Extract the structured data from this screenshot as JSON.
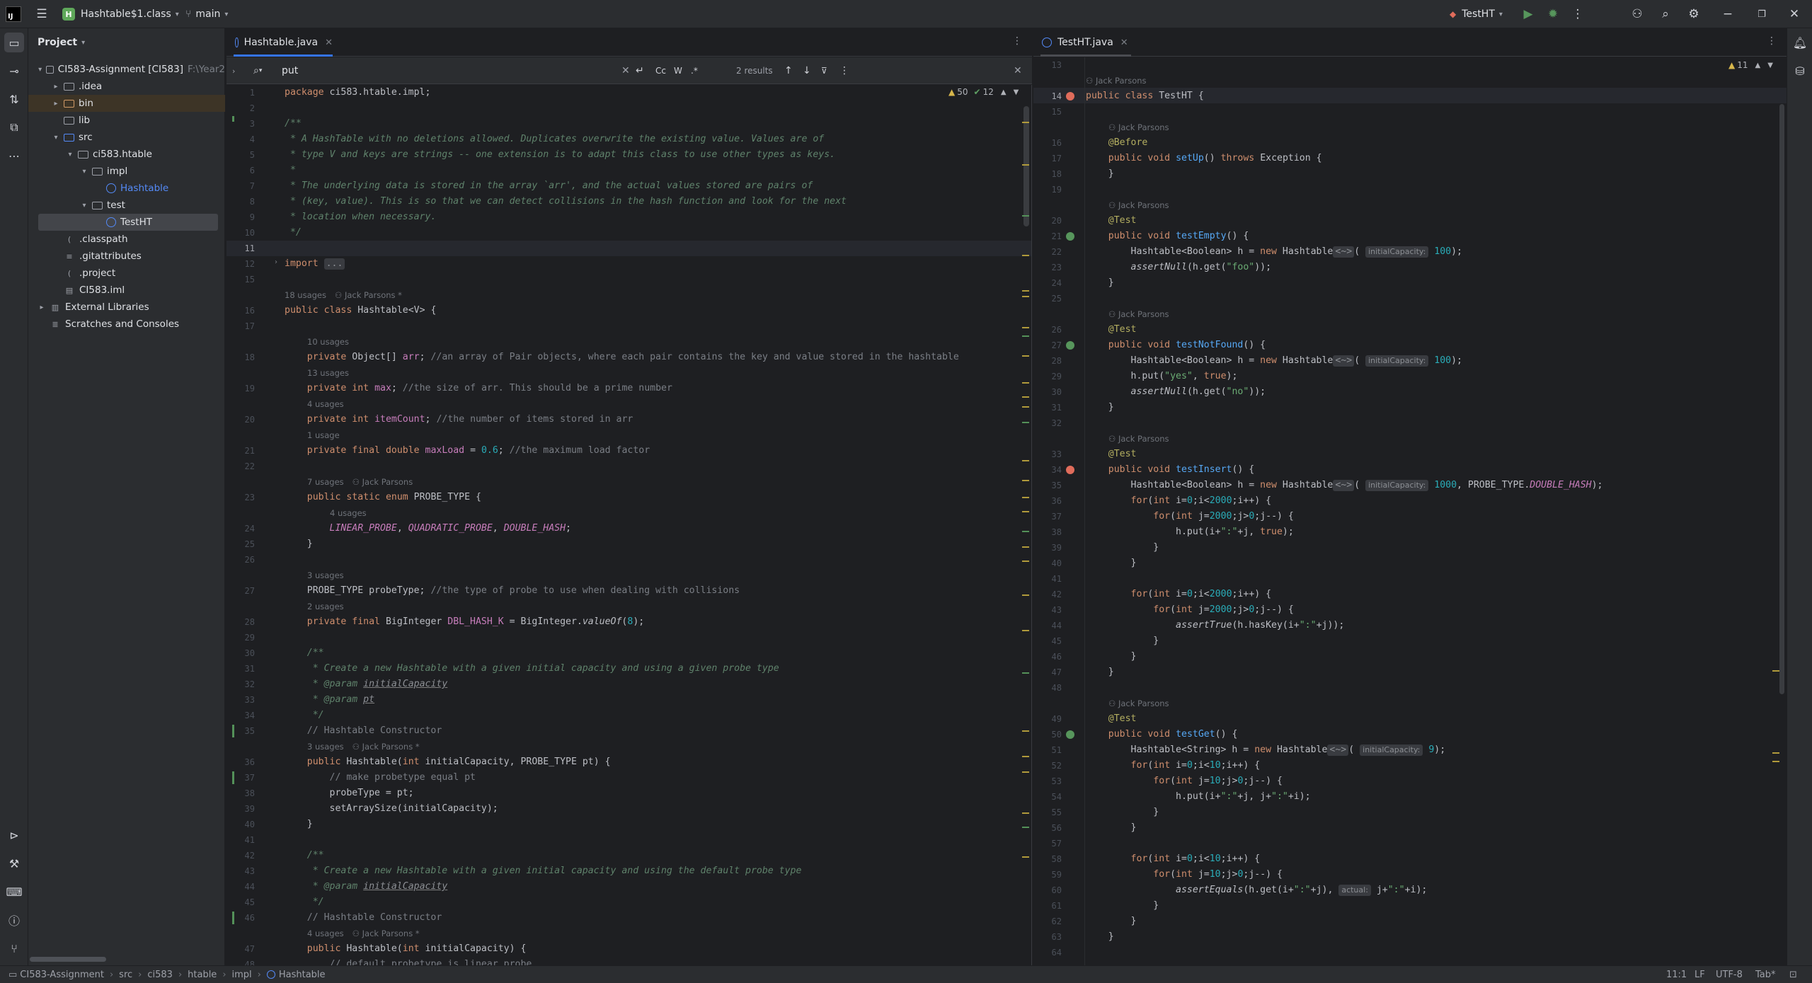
{
  "titlebar": {
    "project_badge": "H",
    "project_name": "Hashtable$1.class",
    "branch": "main",
    "run_config": "TestHT"
  },
  "project_panel": {
    "title": "Project",
    "tree": [
      {
        "label": "CI583-Assignment [CI583]",
        "suffix": "F:\\Year2"
      },
      {
        "label": ".idea"
      },
      {
        "label": "bin"
      },
      {
        "label": "lib"
      },
      {
        "label": "src"
      },
      {
        "label": "ci583.htable"
      },
      {
        "label": "impl"
      },
      {
        "label": "Hashtable"
      },
      {
        "label": "test"
      },
      {
        "label": "TestHT"
      },
      {
        "label": ".classpath"
      },
      {
        "label": ".gitattributes"
      },
      {
        "label": ".project"
      },
      {
        "label": "CI583.iml"
      },
      {
        "label": "External Libraries"
      },
      {
        "label": "Scratches and Consoles"
      }
    ]
  },
  "left_editor": {
    "tab": "Hashtable.java",
    "search": {
      "query": "put",
      "results": "2 results",
      "opt_case": "Cc",
      "opt_words": "W",
      "opt_regex": ".*"
    },
    "problems": {
      "warnings": "50",
      "checks": "12"
    }
  },
  "right_editor": {
    "tab": "TestHT.java",
    "problems": {
      "warnings": "11"
    }
  },
  "statusbar": {
    "breadcrumbs": [
      "CI583-Assignment",
      "src",
      "ci583",
      "htable",
      "impl",
      "Hashtable"
    ],
    "position": "11:1",
    "line_sep": "LF",
    "encoding": "UTF-8",
    "indent": "Tab*"
  },
  "inlays": {
    "u18": "18 usages",
    "u10": "10 usages",
    "u13": "13 usages",
    "u4": "4 usages",
    "u1": "1 usage",
    "u7": "7 usages",
    "u3": "3 usages",
    "u2": "2 usages",
    "author": "Jack Parsons",
    "author_star": "Jack Parsons *"
  },
  "hints": {
    "initialCapacity": "initialCapacity:",
    "actual": "actual:"
  },
  "code_left": [
    {
      "n": "1",
      "text": "package ci583.htable.impl;"
    },
    {
      "n": "2",
      "text": ""
    },
    {
      "n": "3",
      "text": "/**"
    },
    {
      "n": "4",
      "text": " * A HashTable with no deletions allowed. Duplicates overwrite the existing value. Values are of"
    },
    {
      "n": "5",
      "text": " * type V and keys are strings -- one extension is to adapt this class to use other types as keys."
    },
    {
      "n": "6",
      "text": " *"
    },
    {
      "n": "7",
      "text": " * The underlying data is stored in the array `arr', and the actual values stored are pairs of"
    },
    {
      "n": "8",
      "text": " * (key, value). This is so that we can detect collisions in the hash function and look for the next"
    },
    {
      "n": "9",
      "text": " * location when necessary."
    },
    {
      "n": "10",
      "text": " */"
    },
    {
      "n": "11",
      "text": ""
    },
    {
      "n": "12",
      "text": "import ..."
    },
    {
      "n": "15",
      "text": ""
    },
    {
      "n": "16",
      "text": "public class Hashtable<V> {"
    },
    {
      "n": "17",
      "text": ""
    },
    {
      "n": "18",
      "text": "    private Object[] arr; //an array of Pair objects, where each pair contains the key and value stored in the hashtable"
    },
    {
      "n": "19",
      "text": "    private int max; //the size of arr. This should be a prime number"
    },
    {
      "n": "20",
      "text": "    private int itemCount; //the number of items stored in arr"
    },
    {
      "n": "21",
      "text": "    private final double maxLoad = 0.6; //the maximum load factor"
    },
    {
      "n": "22",
      "text": ""
    },
    {
      "n": "23",
      "text": "    public static enum PROBE_TYPE {"
    },
    {
      "n": "24",
      "text": "        LINEAR_PROBE, QUADRATIC_PROBE, DOUBLE_HASH;"
    },
    {
      "n": "25",
      "text": "    }"
    },
    {
      "n": "26",
      "text": ""
    },
    {
      "n": "27",
      "text": "    PROBE_TYPE probeType; //the type of probe to use when dealing with collisions"
    },
    {
      "n": "28",
      "text": "    private final BigInteger DBL_HASH_K = BigInteger.valueOf(8);"
    },
    {
      "n": "29",
      "text": ""
    },
    {
      "n": "30",
      "text": "    /**"
    },
    {
      "n": "31",
      "text": "     * Create a new Hashtable with a given initial capacity and using a given probe type"
    },
    {
      "n": "32",
      "text": "     * @param initialCapacity"
    },
    {
      "n": "33",
      "text": "     * @param pt"
    },
    {
      "n": "34",
      "text": "     */"
    },
    {
      "n": "35",
      "text": "    // Hashtable Constructor"
    },
    {
      "n": "36",
      "text": "    public Hashtable(int initialCapacity, PROBE_TYPE pt) {"
    },
    {
      "n": "37",
      "text": "        // make probetype equal pt"
    },
    {
      "n": "38",
      "text": "        probeType = pt;"
    },
    {
      "n": "39",
      "text": "        setArraySize(initialCapacity);"
    },
    {
      "n": "40",
      "text": "    }"
    },
    {
      "n": "41",
      "text": ""
    },
    {
      "n": "42",
      "text": "    /**"
    },
    {
      "n": "43",
      "text": "     * Create a new Hashtable with a given initial capacity and using the default probe type"
    },
    {
      "n": "44",
      "text": "     * @param initialCapacity"
    },
    {
      "n": "45",
      "text": "     */"
    },
    {
      "n": "46",
      "text": "    // Hashtable Constructor"
    },
    {
      "n": "47",
      "text": "    public Hashtable(int initialCapacity) {"
    },
    {
      "n": "48",
      "text": "        // default probetype is linear probe"
    }
  ],
  "code_right": [
    {
      "n": "13",
      "text": ""
    },
    {
      "n": "14",
      "text": "public class TestHT {"
    },
    {
      "n": "15",
      "text": ""
    },
    {
      "n": "16",
      "text": "    @Before"
    },
    {
      "n": "17",
      "text": "    public void setUp() throws Exception {"
    },
    {
      "n": "18",
      "text": "    }"
    },
    {
      "n": "19",
      "text": ""
    },
    {
      "n": "20",
      "text": "    @Test"
    },
    {
      "n": "21",
      "text": "    public void testEmpty() {"
    },
    {
      "n": "22",
      "text": "        Hashtable<Boolean> h = new Hashtable<~>( 100);"
    },
    {
      "n": "23",
      "text": "        assertNull(h.get(\"foo\"));"
    },
    {
      "n": "24",
      "text": "    }"
    },
    {
      "n": "25",
      "text": ""
    },
    {
      "n": "26",
      "text": "    @Test"
    },
    {
      "n": "27",
      "text": "    public void testNotFound() {"
    },
    {
      "n": "28",
      "text": "        Hashtable<Boolean> h = new Hashtable<~>( 100);"
    },
    {
      "n": "29",
      "text": "        h.put(\"yes\", true);"
    },
    {
      "n": "30",
      "text": "        assertNull(h.get(\"no\"));"
    },
    {
      "n": "31",
      "text": "    }"
    },
    {
      "n": "32",
      "text": ""
    },
    {
      "n": "33",
      "text": "    @Test"
    },
    {
      "n": "34",
      "text": "    public void testInsert() {"
    },
    {
      "n": "35",
      "text": "        Hashtable<Boolean> h = new Hashtable<~>( 1000, PROBE_TYPE.DOUBLE_HASH);"
    },
    {
      "n": "36",
      "text": "        for(int i=0;i<2000;i++) {"
    },
    {
      "n": "37",
      "text": "            for(int j=2000;j>0;j--) {"
    },
    {
      "n": "38",
      "text": "                h.put(i+\":\"+j, true);"
    },
    {
      "n": "39",
      "text": "            }"
    },
    {
      "n": "40",
      "text": "        }"
    },
    {
      "n": "41",
      "text": ""
    },
    {
      "n": "42",
      "text": "        for(int i=0;i<2000;i++) {"
    },
    {
      "n": "43",
      "text": "            for(int j=2000;j>0;j--) {"
    },
    {
      "n": "44",
      "text": "                assertTrue(h.hasKey(i+\":\"+j));"
    },
    {
      "n": "45",
      "text": "            }"
    },
    {
      "n": "46",
      "text": "        }"
    },
    {
      "n": "47",
      "text": "    }"
    },
    {
      "n": "48",
      "text": ""
    },
    {
      "n": "49",
      "text": "    @Test"
    },
    {
      "n": "50",
      "text": "    public void testGet() {"
    },
    {
      "n": "51",
      "text": "        Hashtable<String> h = new Hashtable<~>( 9);"
    },
    {
      "n": "52",
      "text": "        for(int i=0;i<10;i++) {"
    },
    {
      "n": "53",
      "text": "            for(int j=10;j>0;j--) {"
    },
    {
      "n": "54",
      "text": "                h.put(i+\":\"+j, j+\":\"+i);"
    },
    {
      "n": "55",
      "text": "            }"
    },
    {
      "n": "56",
      "text": "        }"
    },
    {
      "n": "57",
      "text": ""
    },
    {
      "n": "58",
      "text": "        for(int i=0;i<10;i++) {"
    },
    {
      "n": "59",
      "text": "            for(int j=10;j>0;j--) {"
    },
    {
      "n": "60",
      "text": "                assertEquals(h.get(i+\":\"+j), j+\":\"+i);"
    },
    {
      "n": "61",
      "text": "            }"
    },
    {
      "n": "62",
      "text": "        }"
    },
    {
      "n": "63",
      "text": "    }"
    },
    {
      "n": "64",
      "text": ""
    }
  ]
}
